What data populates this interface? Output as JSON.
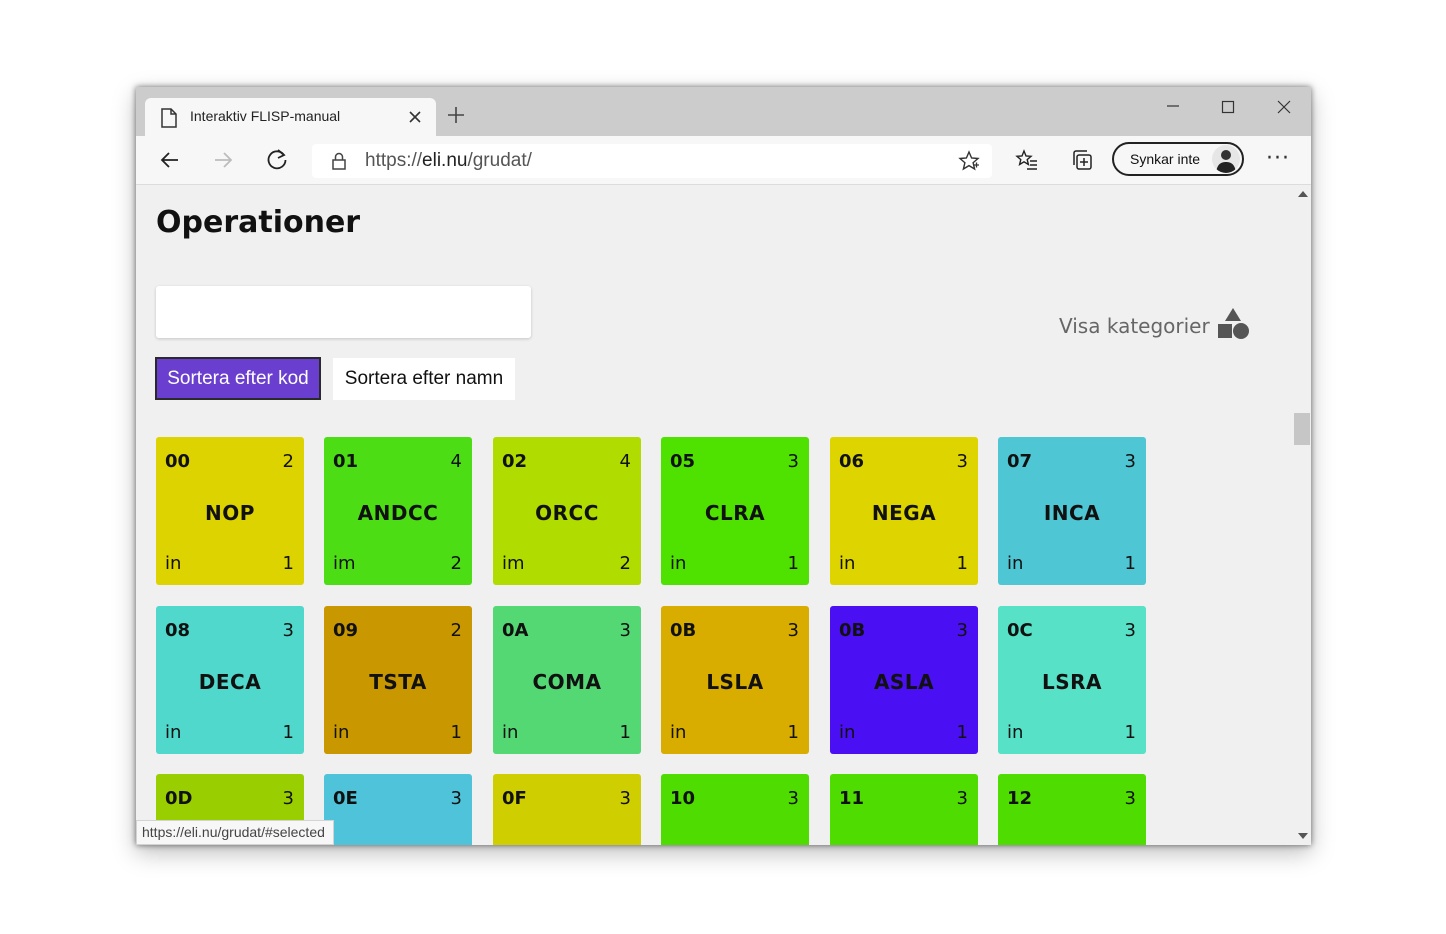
{
  "browser": {
    "tab_title": "Interaktiv FLISP-manual",
    "address_prefix": "https://",
    "address_host": "eli.nu",
    "address_path": "/grudat/",
    "sync_label": "Synkar inte",
    "status_url": "https://eli.nu/grudat/#selected"
  },
  "page": {
    "title": "Operationer",
    "search_value": "",
    "sort_by_code": "Sortera efter kod",
    "sort_by_name": "Sortera efter namn",
    "show_categories": "Visa kategorier"
  },
  "cards": [
    {
      "code": "00",
      "len": "2",
      "name": "NOP",
      "mode": "in",
      "cycles": "1",
      "color": "#ddd300"
    },
    {
      "code": "01",
      "len": "4",
      "name": "ANDCC",
      "mode": "im",
      "cycles": "2",
      "color": "#4cdd14"
    },
    {
      "code": "02",
      "len": "4",
      "name": "ORCC",
      "mode": "im",
      "cycles": "2",
      "color": "#b0dc00"
    },
    {
      "code": "05",
      "len": "3",
      "name": "CLRA",
      "mode": "in",
      "cycles": "1",
      "color": "#4fe200"
    },
    {
      "code": "06",
      "len": "3",
      "name": "NEGA",
      "mode": "in",
      "cycles": "1",
      "color": "#ded500"
    },
    {
      "code": "07",
      "len": "3",
      "name": "INCA",
      "mode": "in",
      "cycles": "1",
      "color": "#4ec6d4"
    },
    {
      "code": "08",
      "len": "3",
      "name": "DECA",
      "mode": "in",
      "cycles": "1",
      "color": "#4fd8cb"
    },
    {
      "code": "09",
      "len": "2",
      "name": "TSTA",
      "mode": "in",
      "cycles": "1",
      "color": "#c99800"
    },
    {
      "code": "0A",
      "len": "3",
      "name": "COMA",
      "mode": "in",
      "cycles": "1",
      "color": "#53d874"
    },
    {
      "code": "0B",
      "len": "3",
      "name": "LSLA",
      "mode": "in",
      "cycles": "1",
      "color": "#d8ad00"
    },
    {
      "code": "0B",
      "len": "3",
      "name": "ASLA",
      "mode": "in",
      "cycles": "1",
      "color": "#4a0ff2"
    },
    {
      "code": "0C",
      "len": "3",
      "name": "LSRA",
      "mode": "in",
      "cycles": "1",
      "color": "#57e1c6"
    },
    {
      "code": "0D",
      "len": "3",
      "name": "",
      "mode": "",
      "cycles": "",
      "color": "#99cf00"
    },
    {
      "code": "0E",
      "len": "3",
      "name": "",
      "mode": "",
      "cycles": "",
      "color": "#4ec3d9"
    },
    {
      "code": "0F",
      "len": "3",
      "name": "",
      "mode": "",
      "cycles": "",
      "color": "#cece00"
    },
    {
      "code": "10",
      "len": "3",
      "name": "",
      "mode": "",
      "cycles": "",
      "color": "#4fdc00"
    },
    {
      "code": "11",
      "len": "3",
      "name": "",
      "mode": "",
      "cycles": "",
      "color": "#4fdc00"
    },
    {
      "code": "12",
      "len": "3",
      "name": "",
      "mode": "",
      "cycles": "",
      "color": "#4fdc00"
    }
  ]
}
